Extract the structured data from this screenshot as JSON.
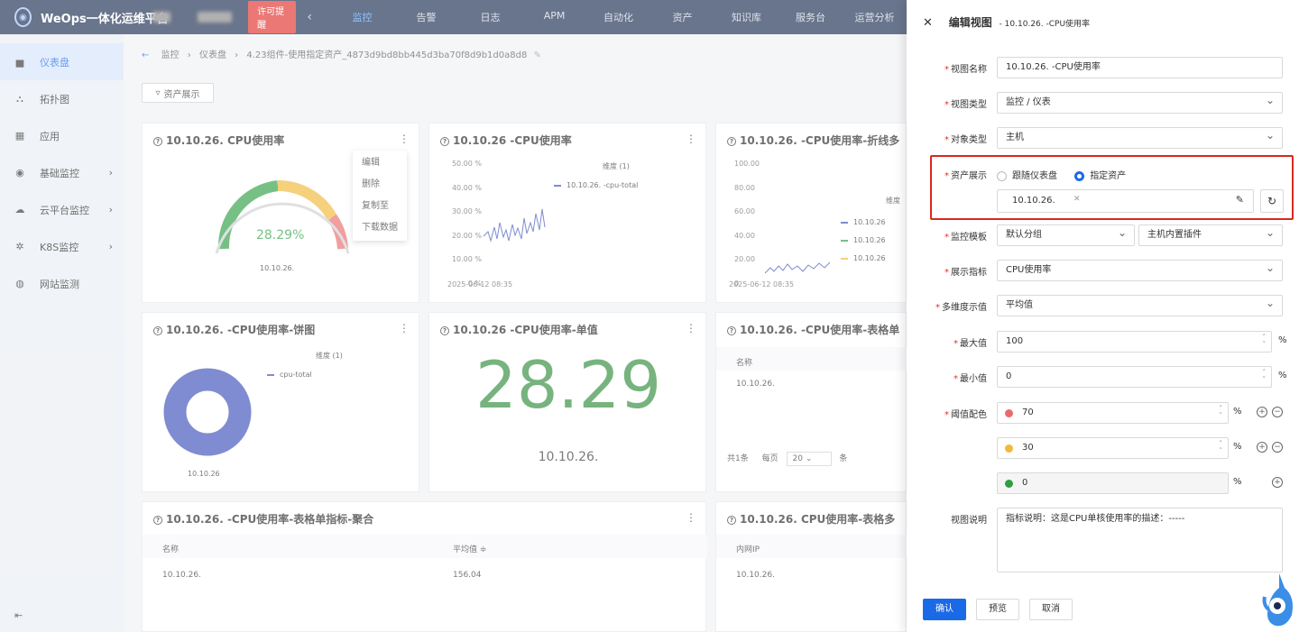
{
  "topbar": {
    "brand": "WeOps一体化运维平台",
    "license": "许可提醒",
    "nav": [
      "监控",
      "告警",
      "日志",
      "APM",
      "自动化",
      "资产",
      "知识库",
      "服务台",
      "运营分析"
    ]
  },
  "sidebar": {
    "items": [
      {
        "label": "仪表盘",
        "icon": "dashboard-icon"
      },
      {
        "label": "拓扑图",
        "icon": "topology-icon"
      },
      {
        "label": "应用",
        "icon": "apps-icon"
      },
      {
        "label": "基础监控",
        "icon": "basic-monitor-icon"
      },
      {
        "label": "云平台监控",
        "icon": "cloud-icon"
      },
      {
        "label": "K8S监控",
        "icon": "k8s-icon"
      },
      {
        "label": "网站监测",
        "icon": "website-icon"
      }
    ]
  },
  "breadcrumb": [
    "监控",
    "仪表盘",
    "4.23组件-使用指定资产_4873d9bd8bb445d3ba70f8d9b1d0a8d8"
  ],
  "filter": "资产展示",
  "panels": {
    "gauge": {
      "title": "10.10.26.    CPU使用率",
      "value": "28.29%",
      "host": "10.10.26.",
      "menu": [
        "编辑",
        "删除",
        "复制至",
        "下载数据"
      ]
    },
    "line": {
      "title": "10.10.26     -CPU使用率",
      "legend_title": "维度 (1)",
      "legend": "10.10.26.     -cpu-total",
      "yticks": [
        "50.00 %",
        "40.00 %",
        "30.00 %",
        "20.00 %",
        "10.00 %",
        "0 %"
      ],
      "xtick": "2025-06-12 08:35"
    },
    "multi": {
      "title": "10.10.26.  -CPU使用率-折线多",
      "legend_title": "维度",
      "yticks": [
        "100.00",
        "80.00",
        "60.00",
        "40.00",
        "20.00",
        "0"
      ],
      "xtick": "2025-06-12 08:35",
      "legend": [
        "10.10.26",
        "10.10.26",
        "10.10.26"
      ]
    },
    "pie": {
      "title": "10.10.26.      -CPU使用率-饼图",
      "legend_title": "维度 (1)",
      "legend": "cpu-total",
      "host": "10.10.26"
    },
    "single": {
      "title": "10.10.26     -CPU使用率-单值",
      "value": "28.29",
      "host": "10.10.26."
    },
    "table1": {
      "title": "10.10.26.      -CPU使用率-表格单",
      "col": "名称",
      "cell": "10.10.26.",
      "total": "共1条",
      "per_page": "每页",
      "page_size": "20",
      "unit": "条"
    },
    "table2": {
      "title": "10.10.26.      -CPU使用率-表格单指标-聚合",
      "cols": [
        "名称",
        "平均值 ≑"
      ],
      "cells": [
        "10.10.26.",
        "156.04"
      ]
    },
    "table3": {
      "title": "10.10.26.      CPU使用率-表格多",
      "col": "内网IP",
      "cell": "10.10.26."
    }
  },
  "drawer": {
    "title": "编辑视图",
    "subtitle": "- 10.10.26.      -CPU使用率",
    "fields": {
      "name": {
        "label": "视图名称",
        "value": "10.10.26.      -CPU使用率"
      },
      "type": {
        "label": "视图类型",
        "value": "监控 / 仪表"
      },
      "object": {
        "label": "对象类型",
        "value": "主机"
      },
      "asset": {
        "label": "资产展示",
        "opt1": "跟随仪表盘",
        "opt2": "指定资产",
        "tag": "10.10.26."
      },
      "template": {
        "label": "监控模板",
        "value1": "默认分组",
        "value2": "主机内置插件"
      },
      "metric": {
        "label": "展示指标",
        "value": "CPU使用率"
      },
      "multi": {
        "label": "多维度示值",
        "value": "平均值"
      },
      "max": {
        "label": "最大值",
        "value": "100",
        "unit": "%"
      },
      "min": {
        "label": "最小值",
        "value": "0",
        "unit": "%"
      },
      "threshold": {
        "label": "阈值配色",
        "rows": [
          {
            "value": "70",
            "color": "#e86b6b"
          },
          {
            "value": "30",
            "color": "#f0b93a"
          },
          {
            "value": "0",
            "color": "#2f9e44"
          }
        ],
        "unit": "%"
      },
      "desc": {
        "label": "视图说明",
        "value": "指标说明：这是CPU单核使用率的描述：-----"
      }
    },
    "buttons": {
      "ok": "确认",
      "preview": "预览",
      "cancel": "取消"
    }
  }
}
